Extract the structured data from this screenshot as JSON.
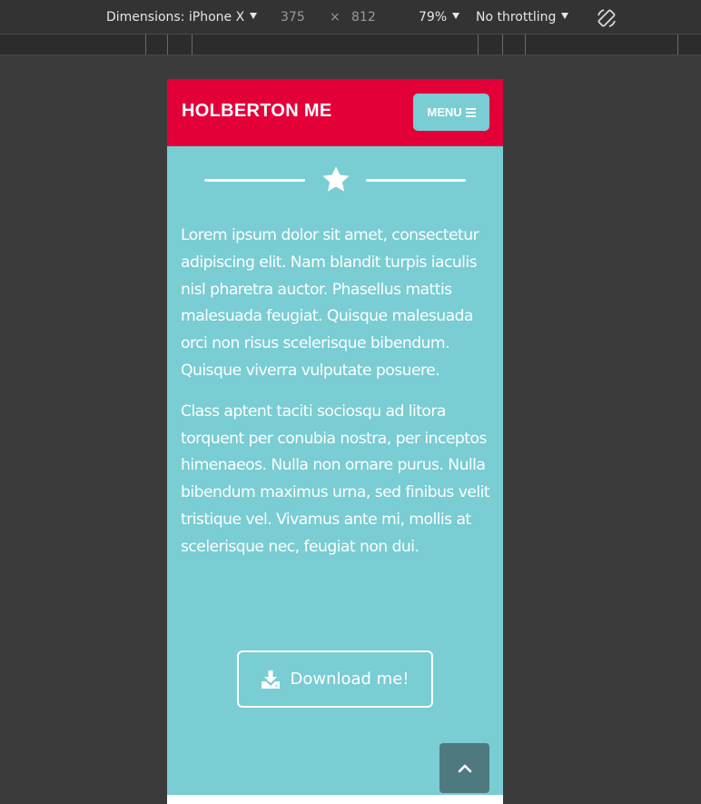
{
  "devtools": {
    "dimensions_label": "Dimensions: iPhone X",
    "width_value": "375",
    "times_symbol": "×",
    "height_value": "812",
    "zoom": "79%",
    "throttling": "No throttling",
    "rotate_icon": "rotate-icon"
  },
  "site": {
    "brand": "HOLBERTON ME",
    "menu_label": "MENU",
    "menu_icon": "hamburger-icon",
    "section_icon": "star-icon",
    "paragraphs": [
      "Lorem ipsum dolor sit amet, consectetur adipiscing elit. Nam blandit turpis iaculis nisl pharetra auctor. Phasellus mattis malesuada feugiat. Quisque malesuada orci non risus scelerisque bibendum. Quisque viverra vulputate posuere.",
      "Class aptent taciti sociosqu ad litora torquent per conubia nostra, per inceptos himenaeos. Nulla non ornare purus. Nulla bibendum maximus urna, sed finibus velit tristique vel. Vivamus ante mi, mollis at scelerisque nec, feugiat non dui."
    ],
    "download_label": "Download me!",
    "download_icon": "download-icon",
    "back_to_top_icon": "chevron-up-icon"
  },
  "colors": {
    "header_bg": "#e30039",
    "content_bg": "#79cdd3",
    "back_to_top_bg": "#4e7a7f",
    "devtools_bg": "#333333"
  }
}
